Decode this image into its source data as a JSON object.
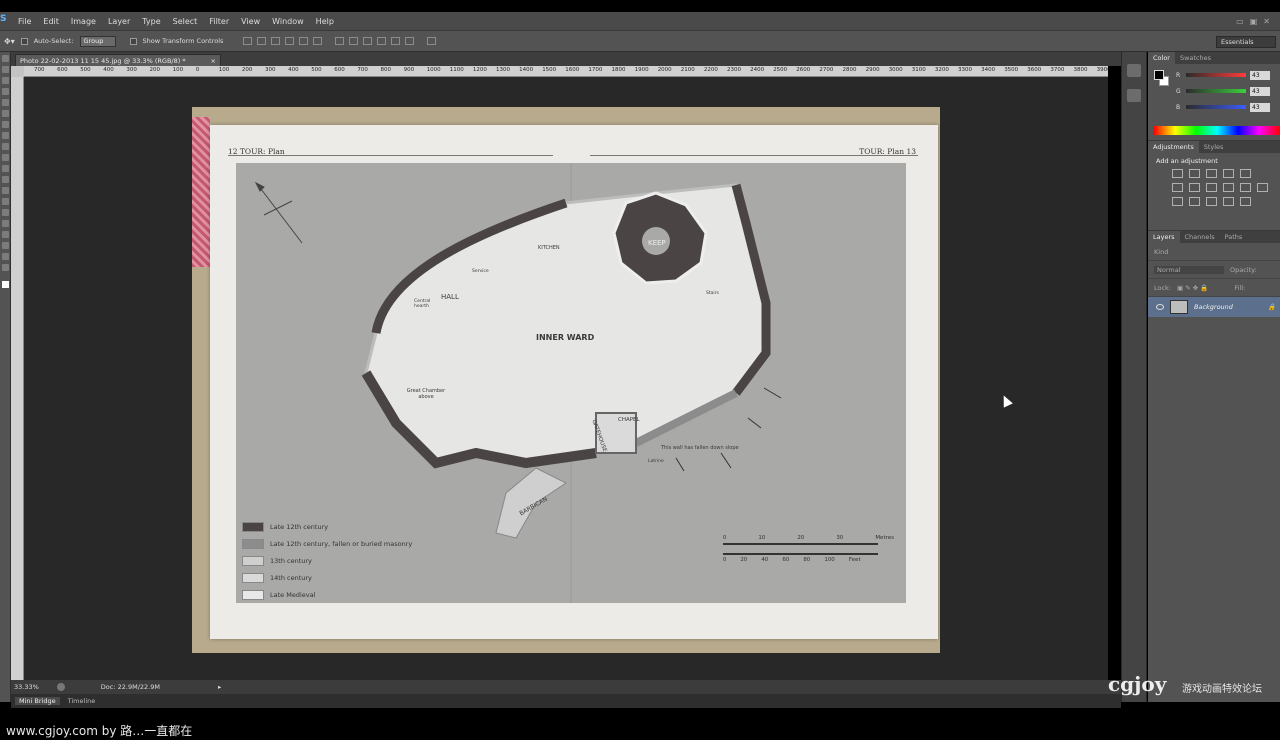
{
  "app": {
    "menu": [
      "File",
      "Edit",
      "Image",
      "Layer",
      "Type",
      "Select",
      "Filter",
      "View",
      "Window",
      "Help"
    ]
  },
  "options_bar": {
    "auto_select_label": "Auto-Select:",
    "auto_select_value": "Group",
    "show_transform_label": "Show Transform Controls",
    "workspace": "Essentials"
  },
  "document": {
    "tab_title": "Photo 22-02-2013 11 15 45.jpg @ 33.3% (RGB/8) *",
    "ruler_marks": [
      "700",
      "600",
      "500",
      "400",
      "300",
      "200",
      "100",
      "0",
      "100",
      "200",
      "300",
      "400",
      "500",
      "600",
      "700",
      "800",
      "900",
      "1000",
      "1100",
      "1200",
      "1300",
      "1400",
      "1500",
      "1600",
      "1700",
      "1800",
      "1900",
      "2000",
      "2100",
      "2200",
      "2300",
      "2400",
      "2500",
      "2600",
      "2700",
      "2800",
      "2900",
      "3000",
      "3100",
      "3200",
      "3300",
      "3400",
      "3500",
      "3600",
      "3700",
      "3800",
      "3900"
    ]
  },
  "image_content": {
    "header_left": "12   TOUR: Plan",
    "header_right": "TOUR: Plan   13",
    "plan_labels": {
      "keep": "KEEP",
      "hall": "HALL",
      "inner_ward": "INNER WARD",
      "kitchen": "KITCHEN",
      "chapel": "CHAPEL",
      "gatehouse": "GATEHOUSE",
      "barbican": "BARBICAN",
      "great_chamber": "Great Chamber above",
      "central_hearth": "Central hearth",
      "wall_fallen": "This wall has fallen down slope",
      "latrine": "Latrine",
      "stairs": "Stairs",
      "service": "Service"
    },
    "legend": [
      {
        "label": "Late 12th century",
        "color": "#4a4444"
      },
      {
        "label": "Late 12th century, fallen or buried masonry",
        "color": "#8c8c8c"
      },
      {
        "label": "13th century",
        "color": "#cfcfcf"
      },
      {
        "label": "14th century",
        "color": "#dadada"
      },
      {
        "label": "Late Medieval",
        "color": "#e8e8e8"
      }
    ],
    "scale_top": [
      "0",
      "10",
      "20",
      "30",
      "Metres"
    ],
    "scale_bottom": [
      "0",
      "20",
      "40",
      "60",
      "80",
      "100",
      "Feet"
    ]
  },
  "status_bar": {
    "zoom": "33.33%",
    "doc": "Doc: 22.9M/22.9M"
  },
  "bottom_tabs": [
    "Mini Bridge",
    "Timeline"
  ],
  "panels": {
    "color_tabs": [
      "Color",
      "Swatches"
    ],
    "rgb": [
      {
        "label": "R",
        "value": "43",
        "color": "#ff3b3b"
      },
      {
        "label": "G",
        "value": "43",
        "color": "#3bd13b"
      },
      {
        "label": "B",
        "value": "43",
        "color": "#3b5bff"
      }
    ],
    "adjust_tabs": [
      "Adjustments",
      "Styles"
    ],
    "adjust_title": "Add an adjustment",
    "layers_tabs": [
      "Layers",
      "Channels",
      "Paths"
    ],
    "kind_label": "Kind",
    "blend_mode": "Normal",
    "opacity_label": "Opacity:",
    "lock_label": "Lock:",
    "fill_label": "Fill:",
    "layer_name": "Background"
  },
  "watermark": {
    "logo": "cgjoy",
    "tagline": "游戏动画特效论坛"
  },
  "footer_text": "www.cgjoy.com by 路…一直都在"
}
